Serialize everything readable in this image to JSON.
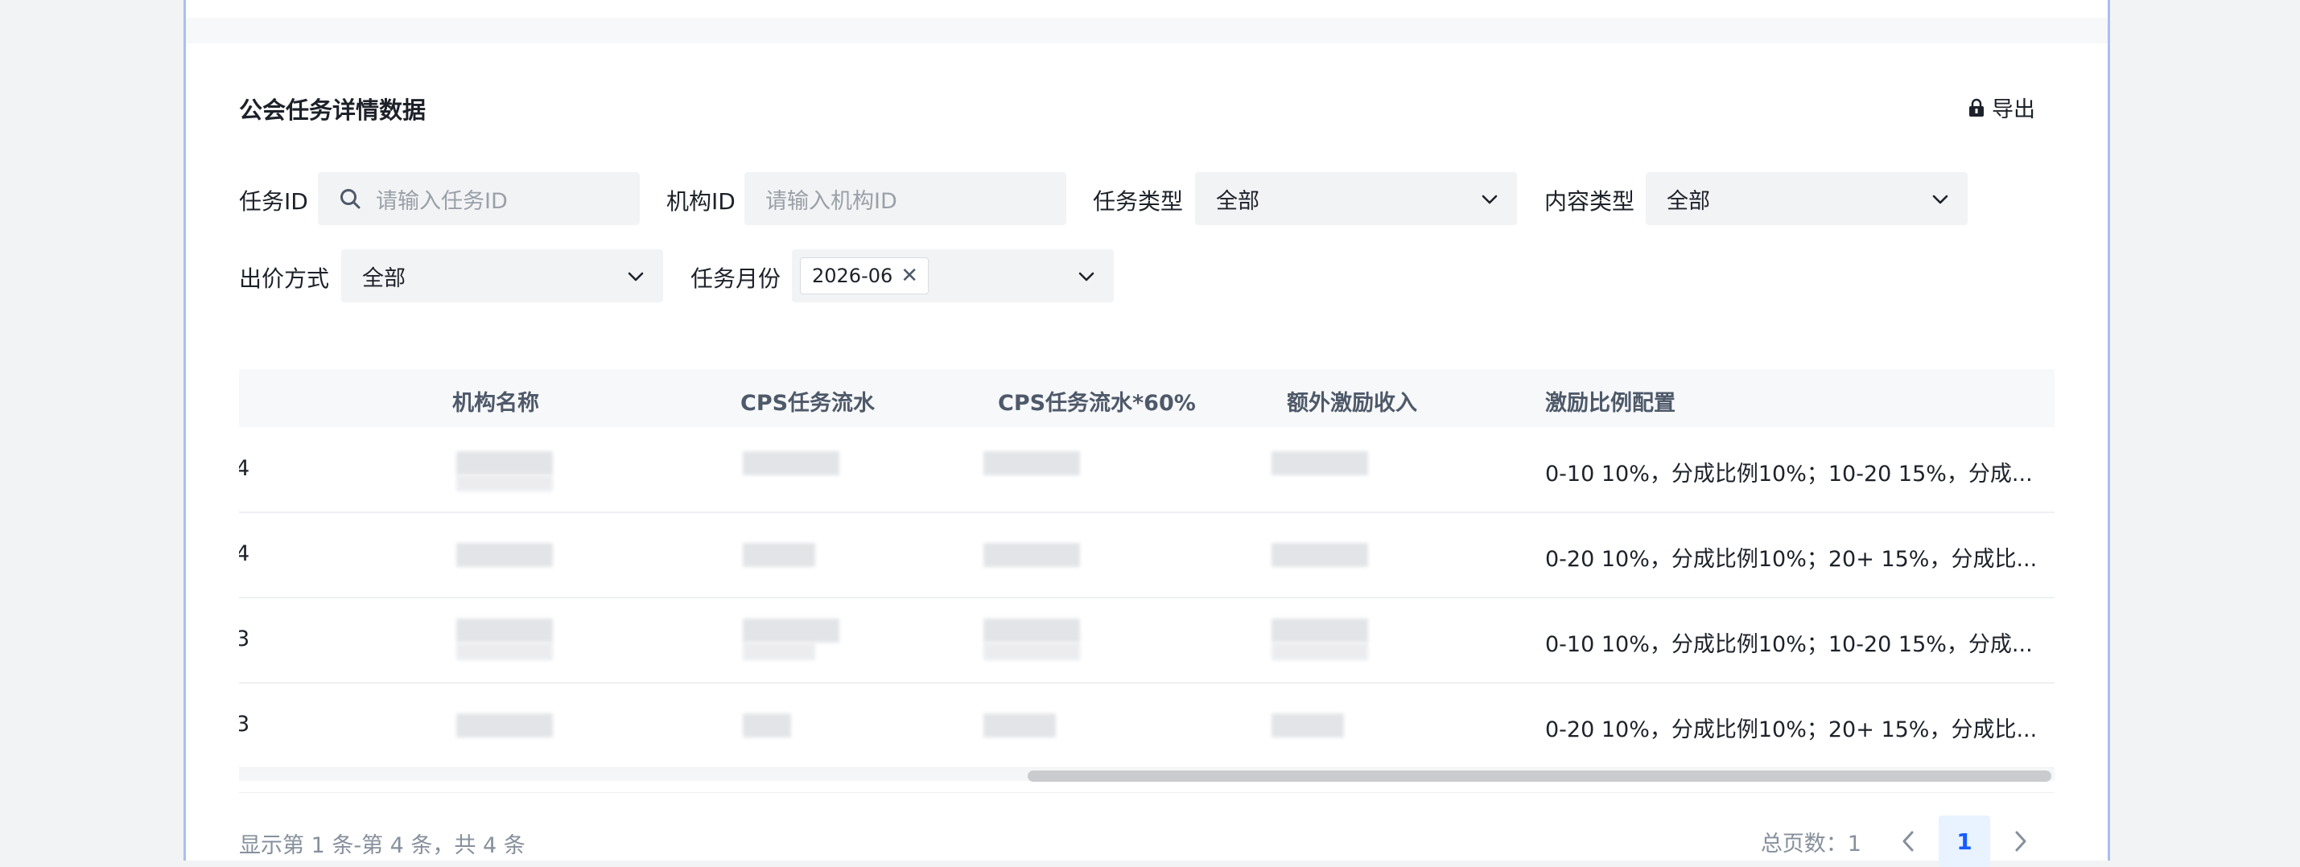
{
  "section": {
    "title": "公会任务详情数据",
    "export_label": "导出"
  },
  "filters": {
    "task_id": {
      "label": "任务ID",
      "placeholder": "请输入任务ID"
    },
    "org_id": {
      "label": "机构ID",
      "placeholder": "请输入机构ID"
    },
    "task_type": {
      "label": "任务类型",
      "value": "全部"
    },
    "content_type": {
      "label": "内容类型",
      "value": "全部"
    },
    "bid_method": {
      "label": "出价方式",
      "value": "全部"
    },
    "task_month": {
      "label": "任务月份",
      "tag": "2026-06",
      "tag_close": "✕"
    }
  },
  "table": {
    "columns": [
      "机构名称",
      "CPS任务流水",
      "CPS任务流水*60%",
      "额外激励收入",
      "激励比例配置"
    ],
    "rows": [
      {
        "id_fragment": "4",
        "incentive_config": "0-10 10%，分成比例10%；10-20 15%，分成..."
      },
      {
        "id_fragment": "4",
        "incentive_config": "0-20 10%，分成比例10%；20+ 15%，分成比..."
      },
      {
        "id_fragment": "3",
        "incentive_config": "0-10 10%，分成比例10%；10-20 15%，分成..."
      },
      {
        "id_fragment": "3",
        "incentive_config": "0-20 10%，分成比例10%；20+ 15%，分成比..."
      }
    ]
  },
  "footer": {
    "summary": "显示第 1 条-第 4 条，共 4 条",
    "total_pages": "总页数：1",
    "current_page": "1"
  },
  "icons": {
    "export": "lock-export-icon",
    "search": "search-icon",
    "dropdown": "chevron-down-icon",
    "prev": "chevron-left-icon",
    "next": "chevron-right-icon"
  },
  "colors": {
    "accent": "#165dff",
    "page_active_bg": "#e8f3ff",
    "frame_border": "#a9bff2"
  }
}
